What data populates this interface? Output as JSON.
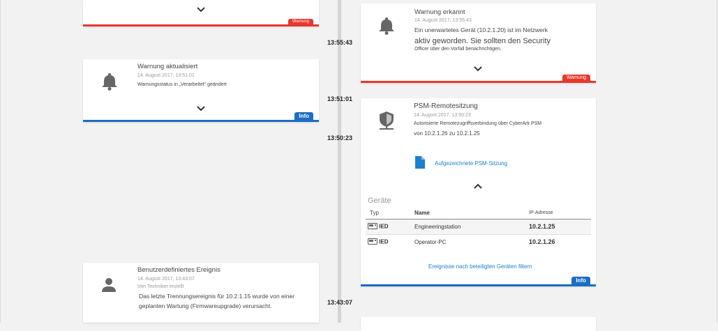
{
  "times": [
    "13:55:43",
    "13:51:01",
    "13:50:23",
    "13:43:07"
  ],
  "card_a": {
    "badge": "Warnung"
  },
  "card_b": {
    "title": "Warnung aktualisiert",
    "timestamp": "14. August 2017, 13:51:01",
    "description": "Warnungsstatus in „Verarbeitet“ geändert",
    "badge": "Info"
  },
  "card_c": {
    "title": "Benutzerdefiniertes Ereignis",
    "timestamp": "14. August 2017, 13:43:07",
    "author": "Von Techniker erstellt",
    "description_1": "Das letzte Trennungsereignis für 10.2.1.15 wurde von einer",
    "description_2": "geplanten Wartung (Firmwareupgrade) verursacht."
  },
  "card_d": {
    "title": "Warnung erkannt",
    "timestamp": "14. August 2017, 13:55:43",
    "line_1": "Ein unerwartetes Gerät (10.2.1.20) ist im Netzwerk",
    "line_2": "aktiv geworden. Sie sollten den Security",
    "line_3": "Officer über den Vorfall benachrichtigen.",
    "badge": "Warnung"
  },
  "card_e": {
    "title": "PSM-Remotesitzung",
    "timestamp": "14. August 2017, 13:50:23",
    "line_1": "Autorisierte Remotezugriffsverbindung über CyberArk PSM",
    "line_2": "von 10.2.1.26 zu 10.2.1.25",
    "recording_link": "Aufgezeichnete PSM-Sitzung",
    "devices_heading": "Geräte",
    "columns": [
      "Typ",
      "Name",
      "IP-Adresse"
    ],
    "rows": [
      {
        "type": "IED",
        "name": "Engineeringstation",
        "ip": "10.2.1.25"
      },
      {
        "type": "IED",
        "name": "Operator-PC",
        "ip": "10.2.1.26"
      }
    ],
    "filter_link": "Ereignisse nach beteiligten Geräten filtern",
    "badge": "Info"
  },
  "colors": {
    "warning": "#e8382d",
    "info": "#1b6ec2",
    "link": "#1b80d0"
  },
  "icons": [
    "bell-icon",
    "person-icon",
    "shield-network-icon",
    "document-icon",
    "device-icon",
    "chevron-down-icon",
    "chevron-up-icon"
  ]
}
